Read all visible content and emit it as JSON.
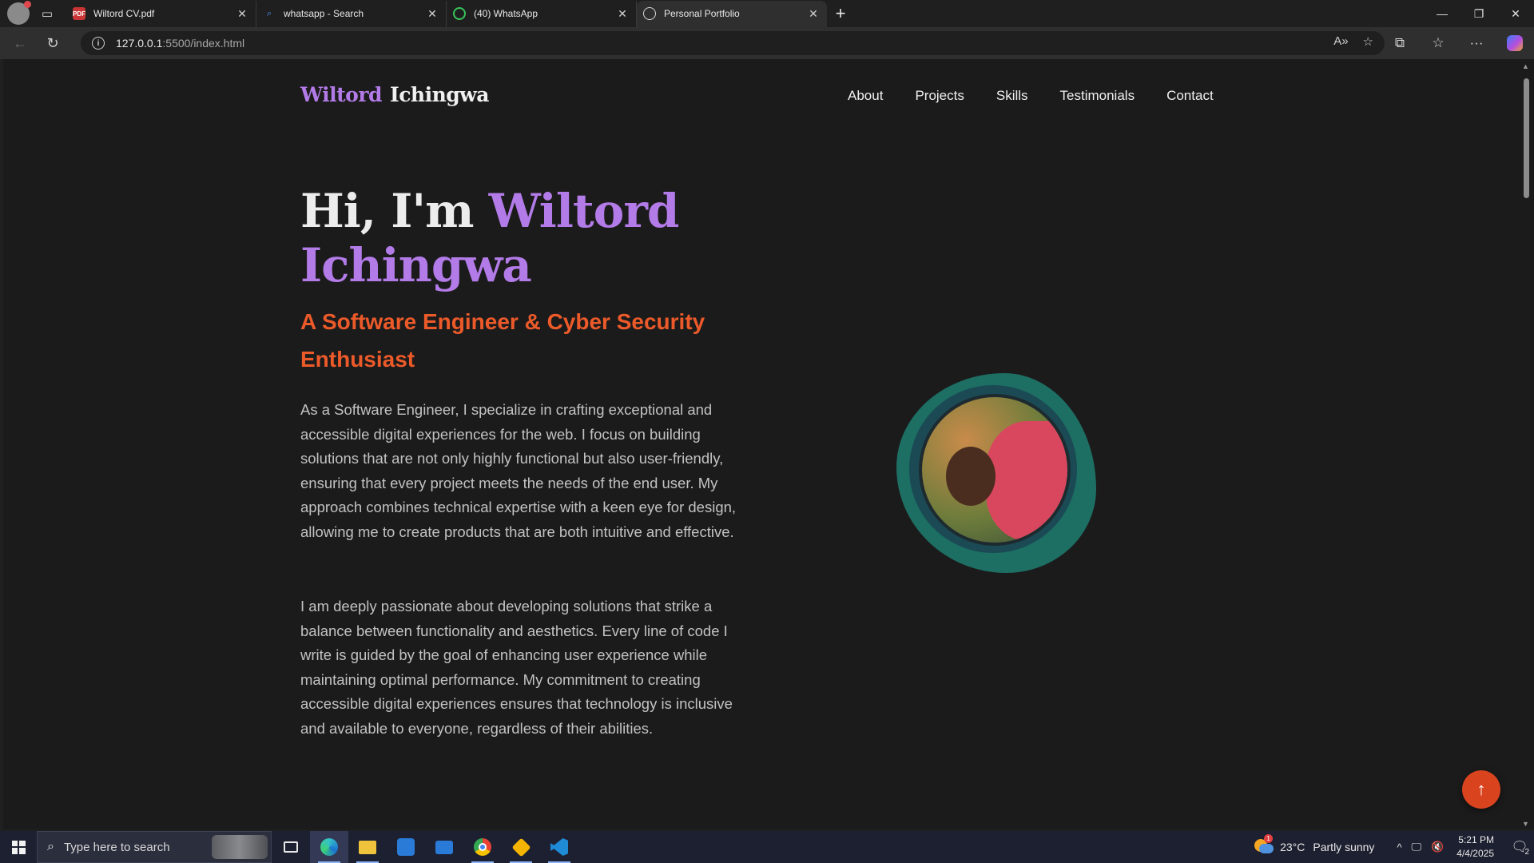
{
  "browser": {
    "tabs": [
      {
        "label": "Wiltord CV.pdf",
        "icon": "pdf-icon"
      },
      {
        "label": "whatsapp - Search",
        "icon": "search-icon"
      },
      {
        "label": "(40) WhatsApp",
        "icon": "whatsapp-icon"
      },
      {
        "label": "Personal Portfolio",
        "icon": "globe-icon",
        "active": true
      }
    ],
    "url_host": "127.0.0.1",
    "url_path": ":5500/index.html"
  },
  "site": {
    "logo_first": "Wiltord",
    "logo_last": "Ichingwa",
    "nav": [
      "About",
      "Projects",
      "Skills",
      "Testimonials",
      "Contact"
    ],
    "hero": {
      "greeting": "Hi, I'm ",
      "name": "Wiltord Ichingwa",
      "subtitle": "A Software Engineer & Cyber Security Enthusiast",
      "paragraph1": "As a Software Engineer, I specialize in crafting exceptional and accessible digital experiences for the web. I focus on building solutions that are not only highly functional but also user-friendly, ensuring that every project meets the needs of the end user. My approach combines technical expertise with a keen eye for design, allowing me to create products that are both intuitive and effective.",
      "paragraph2": "I am deeply passionate about developing solutions that strike a balance between functionality and aesthetics. Every line of code I write is guided by the goal of enhancing user experience while maintaining optimal performance. My commitment to creating accessible digital experiences ensures that technology is inclusive and available to everyone, regardless of their abilities."
    },
    "colors": {
      "accent_purple": "#b37be8",
      "accent_orange": "#ec5a2a",
      "background": "#1b1b1b"
    }
  },
  "taskbar": {
    "search_placeholder": "Type here to search",
    "weather_temp": "23°C",
    "weather_condition": "Partly sunny",
    "weather_badge": "1",
    "time": "5:21 PM",
    "date": "4/4/2025",
    "notification_count": "2"
  }
}
